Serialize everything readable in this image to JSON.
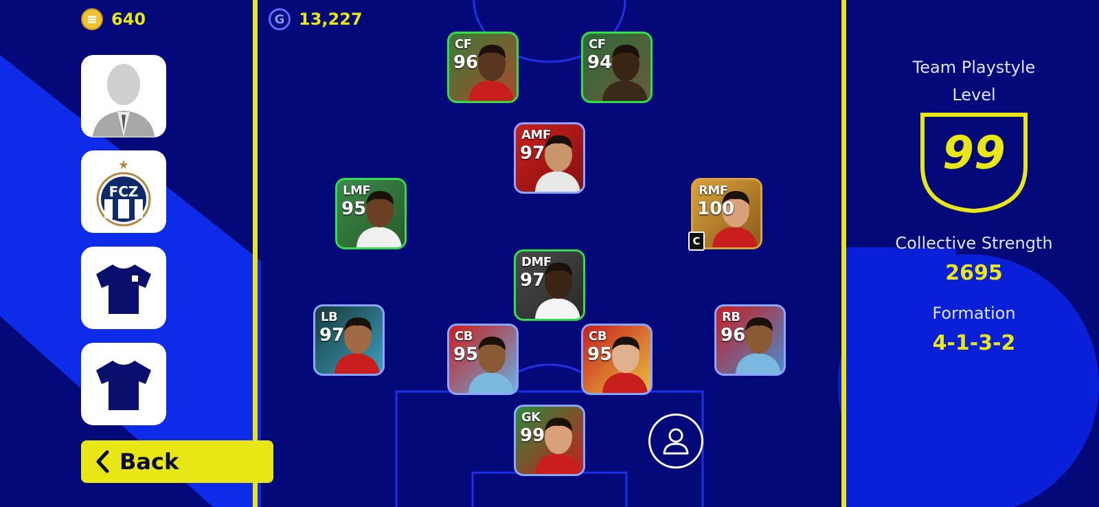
{
  "currency": {
    "coins": "640",
    "gp": "13,227",
    "gp_icon_letter": "G"
  },
  "sidebar": {
    "items": [
      {
        "name": "manager-portrait",
        "icon": "manager-silhouette-icon"
      },
      {
        "name": "team-crest",
        "icon": "fcz-crest-icon",
        "crest_text": "FCZ",
        "crest_star": "★"
      },
      {
        "name": "home-kit",
        "icon": "home-kit-shirt-icon"
      },
      {
        "name": "away-kit",
        "icon": "away-kit-shirt-icon"
      }
    ],
    "back_label": "Back"
  },
  "squad": [
    {
      "pos": "CF",
      "rating": "96",
      "border": "green",
      "skin": "#5a3520",
      "kit": "#c81e1e",
      "bg": [
        "#3a7b3a",
        "#a84a2a"
      ]
    },
    {
      "pos": "CF",
      "rating": "94",
      "border": "green",
      "skin": "#3a2515",
      "kit": "#3a2a1a",
      "bg": [
        "#2d6a3a",
        "#6a5a3a"
      ]
    },
    {
      "pos": "AMF",
      "rating": "97",
      "border": "blue",
      "skin": "#c9966b",
      "kit": "#e8e8e8",
      "bg": [
        "#c81e1e",
        "#8a1010"
      ]
    },
    {
      "pos": "LMF",
      "rating": "95",
      "border": "green",
      "skin": "#6a4025",
      "kit": "#f0f0f0",
      "bg": [
        "#3a8a4a",
        "#2a5a2a"
      ]
    },
    {
      "pos": "RMF",
      "rating": "100",
      "border": "gold",
      "skin": "#d9a17a",
      "kit": "#c81e1e",
      "bg": [
        "#d9a23c",
        "#8a5a1a"
      ],
      "captain": "C"
    },
    {
      "pos": "DMF",
      "rating": "97",
      "border": "green",
      "skin": "#3a2515",
      "kit": "#f5f5f5",
      "bg": [
        "#4a4a4a",
        "#2a2a2a"
      ]
    },
    {
      "pos": "LB",
      "rating": "97",
      "border": "blue",
      "skin": "#a06a45",
      "kit": "#c81e1e",
      "bg": [
        "#1a3a3a",
        "#3aa0c0"
      ]
    },
    {
      "pos": "CB",
      "rating": "95",
      "border": "blue",
      "skin": "#8a5a35",
      "kit": "#7ab8e0",
      "bg": [
        "#c81e1e",
        "#6ab0e0"
      ]
    },
    {
      "pos": "CB",
      "rating": "95",
      "border": "blue",
      "skin": "#e0b090",
      "kit": "#c81e1e",
      "bg": [
        "#c81e1e",
        "#e8c040"
      ]
    },
    {
      "pos": "RB",
      "rating": "96",
      "border": "blue",
      "skin": "#8a5a35",
      "kit": "#7ab8e0",
      "bg": [
        "#c81e1e",
        "#4a8ad0"
      ]
    },
    {
      "pos": "GK",
      "rating": "99",
      "border": "blue",
      "skin": "#d9a17a",
      "kit": "#c81e1e",
      "bg": [
        "#2a8a3a",
        "#c81e1e"
      ]
    }
  ],
  "stats": {
    "playstyle_label": "Team Playstyle Level",
    "playstyle_value": "99",
    "strength_label": "Collective Strength",
    "strength_value": "2695",
    "formation_label": "Formation",
    "formation_value": "4-1-3-2"
  },
  "colors": {
    "accent": "#e8e614",
    "background": "#04097a",
    "pitch_line": "#e8e614",
    "decor_stripe": "#0d2be8"
  }
}
